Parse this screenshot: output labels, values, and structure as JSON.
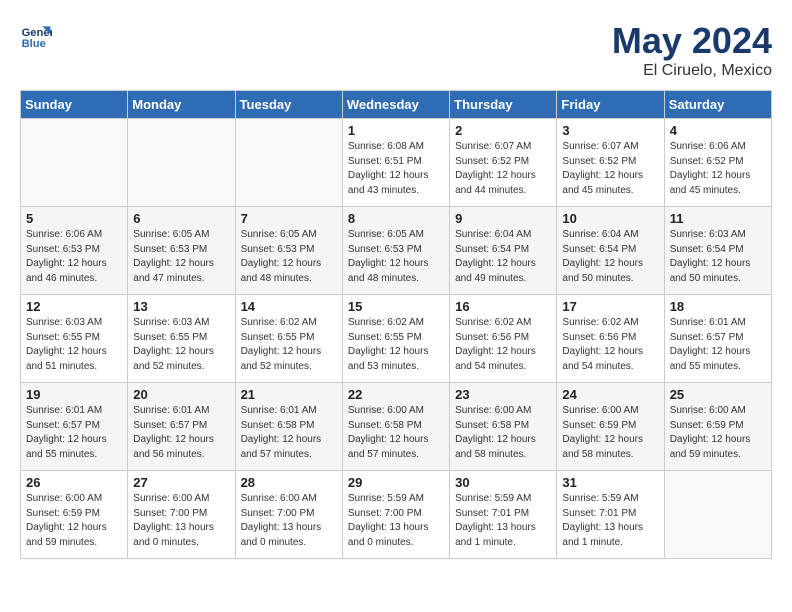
{
  "header": {
    "logo_line1": "General",
    "logo_line2": "Blue",
    "month_year": "May 2024",
    "location": "El Ciruelo, Mexico"
  },
  "days_of_week": [
    "Sunday",
    "Monday",
    "Tuesday",
    "Wednesday",
    "Thursday",
    "Friday",
    "Saturday"
  ],
  "weeks": [
    [
      {
        "day": "",
        "info": ""
      },
      {
        "day": "",
        "info": ""
      },
      {
        "day": "",
        "info": ""
      },
      {
        "day": "1",
        "info": "Sunrise: 6:08 AM\nSunset: 6:51 PM\nDaylight: 12 hours\nand 43 minutes."
      },
      {
        "day": "2",
        "info": "Sunrise: 6:07 AM\nSunset: 6:52 PM\nDaylight: 12 hours\nand 44 minutes."
      },
      {
        "day": "3",
        "info": "Sunrise: 6:07 AM\nSunset: 6:52 PM\nDaylight: 12 hours\nand 45 minutes."
      },
      {
        "day": "4",
        "info": "Sunrise: 6:06 AM\nSunset: 6:52 PM\nDaylight: 12 hours\nand 45 minutes."
      }
    ],
    [
      {
        "day": "5",
        "info": "Sunrise: 6:06 AM\nSunset: 6:53 PM\nDaylight: 12 hours\nand 46 minutes."
      },
      {
        "day": "6",
        "info": "Sunrise: 6:05 AM\nSunset: 6:53 PM\nDaylight: 12 hours\nand 47 minutes."
      },
      {
        "day": "7",
        "info": "Sunrise: 6:05 AM\nSunset: 6:53 PM\nDaylight: 12 hours\nand 48 minutes."
      },
      {
        "day": "8",
        "info": "Sunrise: 6:05 AM\nSunset: 6:53 PM\nDaylight: 12 hours\nand 48 minutes."
      },
      {
        "day": "9",
        "info": "Sunrise: 6:04 AM\nSunset: 6:54 PM\nDaylight: 12 hours\nand 49 minutes."
      },
      {
        "day": "10",
        "info": "Sunrise: 6:04 AM\nSunset: 6:54 PM\nDaylight: 12 hours\nand 50 minutes."
      },
      {
        "day": "11",
        "info": "Sunrise: 6:03 AM\nSunset: 6:54 PM\nDaylight: 12 hours\nand 50 minutes."
      }
    ],
    [
      {
        "day": "12",
        "info": "Sunrise: 6:03 AM\nSunset: 6:55 PM\nDaylight: 12 hours\nand 51 minutes."
      },
      {
        "day": "13",
        "info": "Sunrise: 6:03 AM\nSunset: 6:55 PM\nDaylight: 12 hours\nand 52 minutes."
      },
      {
        "day": "14",
        "info": "Sunrise: 6:02 AM\nSunset: 6:55 PM\nDaylight: 12 hours\nand 52 minutes."
      },
      {
        "day": "15",
        "info": "Sunrise: 6:02 AM\nSunset: 6:55 PM\nDaylight: 12 hours\nand 53 minutes."
      },
      {
        "day": "16",
        "info": "Sunrise: 6:02 AM\nSunset: 6:56 PM\nDaylight: 12 hours\nand 54 minutes."
      },
      {
        "day": "17",
        "info": "Sunrise: 6:02 AM\nSunset: 6:56 PM\nDaylight: 12 hours\nand 54 minutes."
      },
      {
        "day": "18",
        "info": "Sunrise: 6:01 AM\nSunset: 6:57 PM\nDaylight: 12 hours\nand 55 minutes."
      }
    ],
    [
      {
        "day": "19",
        "info": "Sunrise: 6:01 AM\nSunset: 6:57 PM\nDaylight: 12 hours\nand 55 minutes."
      },
      {
        "day": "20",
        "info": "Sunrise: 6:01 AM\nSunset: 6:57 PM\nDaylight: 12 hours\nand 56 minutes."
      },
      {
        "day": "21",
        "info": "Sunrise: 6:01 AM\nSunset: 6:58 PM\nDaylight: 12 hours\nand 57 minutes."
      },
      {
        "day": "22",
        "info": "Sunrise: 6:00 AM\nSunset: 6:58 PM\nDaylight: 12 hours\nand 57 minutes."
      },
      {
        "day": "23",
        "info": "Sunrise: 6:00 AM\nSunset: 6:58 PM\nDaylight: 12 hours\nand 58 minutes."
      },
      {
        "day": "24",
        "info": "Sunrise: 6:00 AM\nSunset: 6:59 PM\nDaylight: 12 hours\nand 58 minutes."
      },
      {
        "day": "25",
        "info": "Sunrise: 6:00 AM\nSunset: 6:59 PM\nDaylight: 12 hours\nand 59 minutes."
      }
    ],
    [
      {
        "day": "26",
        "info": "Sunrise: 6:00 AM\nSunset: 6:59 PM\nDaylight: 12 hours\nand 59 minutes."
      },
      {
        "day": "27",
        "info": "Sunrise: 6:00 AM\nSunset: 7:00 PM\nDaylight: 13 hours\nand 0 minutes."
      },
      {
        "day": "28",
        "info": "Sunrise: 6:00 AM\nSunset: 7:00 PM\nDaylight: 13 hours\nand 0 minutes."
      },
      {
        "day": "29",
        "info": "Sunrise: 5:59 AM\nSunset: 7:00 PM\nDaylight: 13 hours\nand 0 minutes."
      },
      {
        "day": "30",
        "info": "Sunrise: 5:59 AM\nSunset: 7:01 PM\nDaylight: 13 hours\nand 1 minute."
      },
      {
        "day": "31",
        "info": "Sunrise: 5:59 AM\nSunset: 7:01 PM\nDaylight: 13 hours\nand 1 minute."
      },
      {
        "day": "",
        "info": ""
      }
    ]
  ]
}
